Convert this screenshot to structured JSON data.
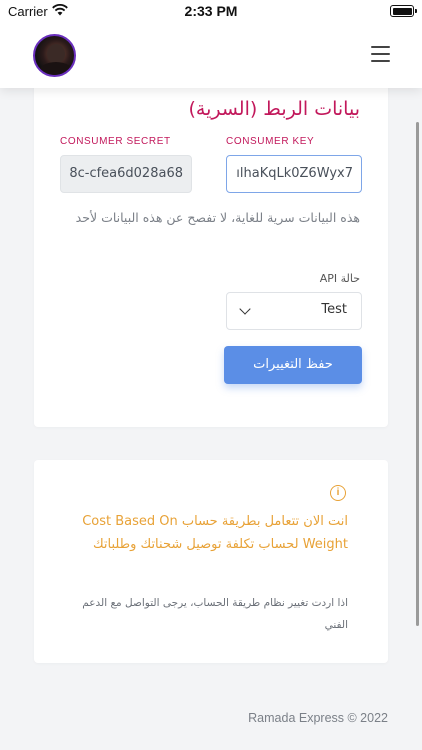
{
  "statusbar": {
    "carrier": "Carrier",
    "time": "2:33 PM"
  },
  "header": {
    "menu_icon": "hamburger-menu-icon"
  },
  "credentials": {
    "title": "بيانات الربط (السرية)",
    "consumer_secret_label": "CONSUMER SECRET",
    "consumer_secret_value": "8c-cfea6d028a68",
    "consumer_key_label": "CONSUMER KEY",
    "consumer_key_value": "ılhaKqLk0Z6Wyx7",
    "warning": "هذه البيانات سرية للغاية، لا تفصح عن هذه البيانات لأحد"
  },
  "api": {
    "label": "حالة API",
    "selected": "Test"
  },
  "save_label": "حفظ التغييرات",
  "notice": {
    "icon": "info-icon",
    "text": "انت الان تتعامل بطريقة حساب Cost Based On Weight لحساب تكلفة توصيل شحناتك وطلباتك",
    "subtext": "اذا اردت تغيير نظام طريقة الحساب، يرجى التواصل مع الدعم الفني"
  },
  "footer": "Ramada Express © 2022",
  "colors": {
    "accent": "#5b8ee6",
    "title": "#c2185b",
    "notice": "#e8a237"
  }
}
